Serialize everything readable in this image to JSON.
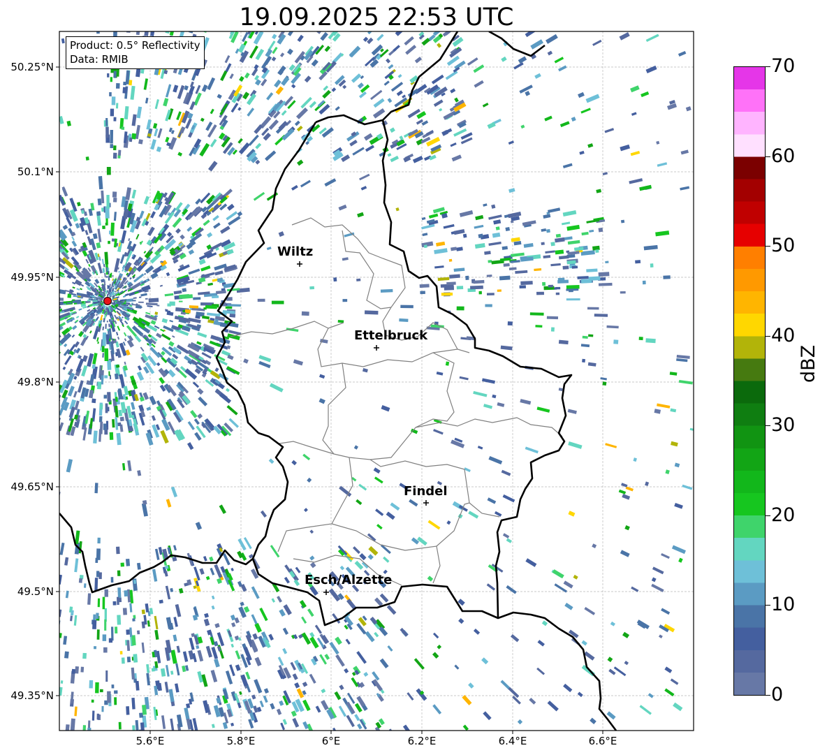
{
  "title": "19.09.2025 22:53 UTC",
  "info": {
    "product": "Product: 0.5° Reflectivity",
    "data_source": "Data: RMIB"
  },
  "axes": {
    "lat_ticks": [
      "50.25°N",
      "50.1°N",
      "49.95°N",
      "49.8°N",
      "49.65°N",
      "49.5°N",
      "49.35°N"
    ],
    "lon_ticks": [
      "5.6°E",
      "5.8°E",
      "6°E",
      "6.2°E",
      "6.4°E",
      "6.6°E"
    ],
    "grid": true
  },
  "cities": [
    {
      "name": "Wiltz"
    },
    {
      "name": "Ettelbruck"
    },
    {
      "name": "Findel"
    },
    {
      "name": "Esch/Alzette"
    }
  ],
  "radar_site_color": "#e8141a",
  "colorbar": {
    "label": "dBZ",
    "min": 0,
    "max": 70,
    "ticks": [
      "0",
      "10",
      "20",
      "30",
      "40",
      "50",
      "60",
      "70"
    ],
    "colors": [
      "#6778a6",
      "#55699f",
      "#445f9f",
      "#4a74a7",
      "#5b9bc3",
      "#6ec0d8",
      "#63d6c0",
      "#3fd46b",
      "#16c61f",
      "#12b71b",
      "#12a515",
      "#119412",
      "#0f7e11",
      "#0b6a0c",
      "#467a10",
      "#b2b409",
      "#ffd700",
      "#ffb500",
      "#ff9900",
      "#ff7f00",
      "#e60000",
      "#c00000",
      "#a30000",
      "#7b0000",
      "#ffe0ff",
      "#ffb4ff",
      "#ff72f8",
      "#e536e8"
    ]
  }
}
